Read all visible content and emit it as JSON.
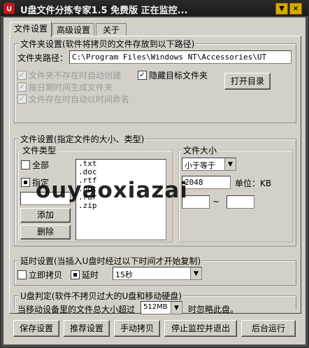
{
  "window": {
    "title": "U盘文件分拣专家1.5 免费版  正在监控...",
    "icon": "magnet-icon",
    "buttons": {
      "menu": "▼",
      "close": "×"
    }
  },
  "tabs": [
    {
      "label": "文件设置",
      "active": true
    },
    {
      "label": "高级设置",
      "active": false
    },
    {
      "label": "关于",
      "active": false
    }
  ],
  "folder_group": {
    "title": "文件夹设置(软件将拷贝的文件存放到以下路径)",
    "path_label": "文件夹路径：",
    "path_value": "C:\\Program Files\\Windows NT\\Accessories\\UT",
    "options": [
      {
        "label": "文件夹不存在时自动创建",
        "checked": true,
        "enabled": false
      },
      {
        "label": "按日期时间生成文件夹",
        "checked": true,
        "enabled": false
      },
      {
        "label": "文件存在时自动以时间命名",
        "checked": true,
        "enabled": false
      }
    ],
    "hide_target": {
      "label": "隐藏目标文件夹",
      "checked": true
    },
    "open_dir_button": "打开目录"
  },
  "file_settings": {
    "title": "文件设置(指定文件的大小、类型)",
    "type_group": {
      "title": "文件类型",
      "all": {
        "label": "全部",
        "selected": false
      },
      "specify": {
        "label": "指定",
        "selected": true
      },
      "input_value": "",
      "add_button": "添加",
      "delete_button": "删除",
      "extensions": [
        ".txt",
        ".doc",
        ".rtf",
        ".ppt",
        ".rar",
        ".zip"
      ]
    },
    "size_group": {
      "title": "文件大小",
      "comparison": "小于等于",
      "size_value": "2048",
      "unit": "单位：KB",
      "range_separator": "~"
    }
  },
  "delay_group": {
    "title": "延时设置(当插入U盘时经过以下时间才开始复制)",
    "immediate": {
      "label": "立即拷贝",
      "selected": false
    },
    "delay": {
      "label": "延时",
      "selected": true
    },
    "delay_value": "15秒"
  },
  "udisk_group": {
    "title": "U盘判定(软件不拷贝过大的U盘和移动硬盘)",
    "prefix": "当移动设备里的文件总大小超过",
    "limit": "512MB",
    "suffix": "时忽略此盘。"
  },
  "bottom_buttons": [
    "保存设置",
    "推荐设置",
    "手动拷贝",
    "停止监控并退出",
    "后台运行"
  ],
  "watermark": "ouyaoxiazai"
}
